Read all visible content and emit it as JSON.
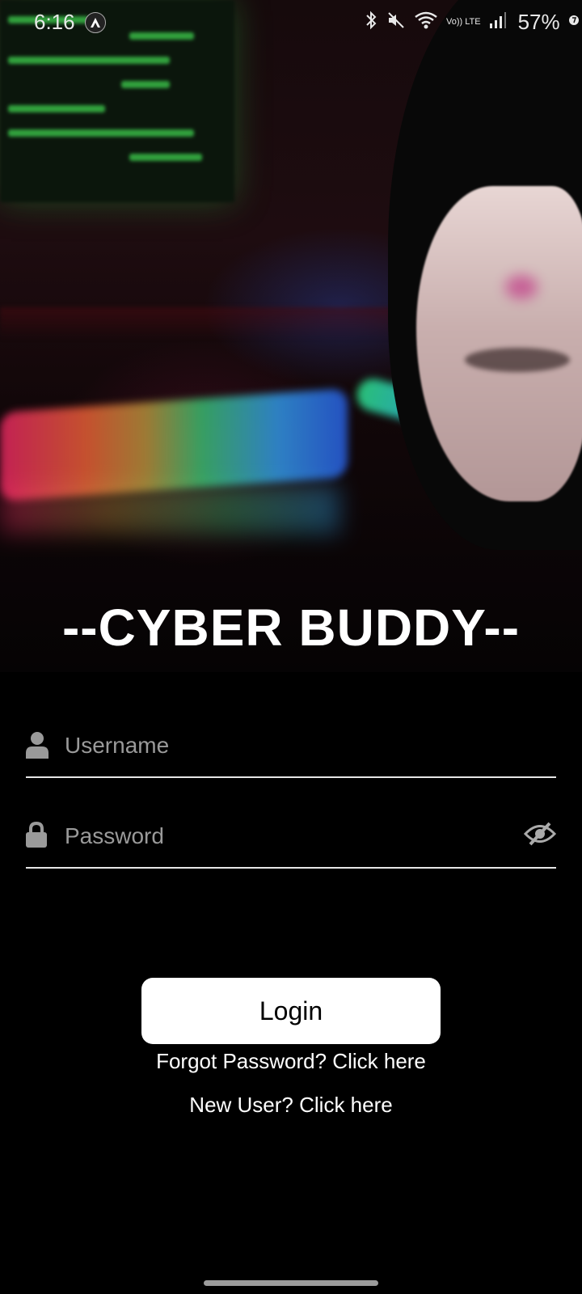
{
  "status_bar": {
    "time": "6:16",
    "battery": "57%",
    "network_label": "Vo)) LTE",
    "icons": [
      "bluetooth-icon",
      "mute-icon",
      "wifi-icon",
      "signal-icon",
      "battery-icon"
    ]
  },
  "hero": {
    "title": "--CYBER BUDDY--"
  },
  "form": {
    "username_placeholder": "Username",
    "password_placeholder": "Password",
    "username_value": "",
    "password_value": ""
  },
  "actions": {
    "login_label": "Login",
    "forgot_label": "Forgot Password? Click here",
    "new_user_label": "New User? Click here"
  },
  "colors": {
    "background": "#000000",
    "button_bg": "#ffffff",
    "underline": "#e6e6e6",
    "placeholder": "#9a9a9a"
  }
}
